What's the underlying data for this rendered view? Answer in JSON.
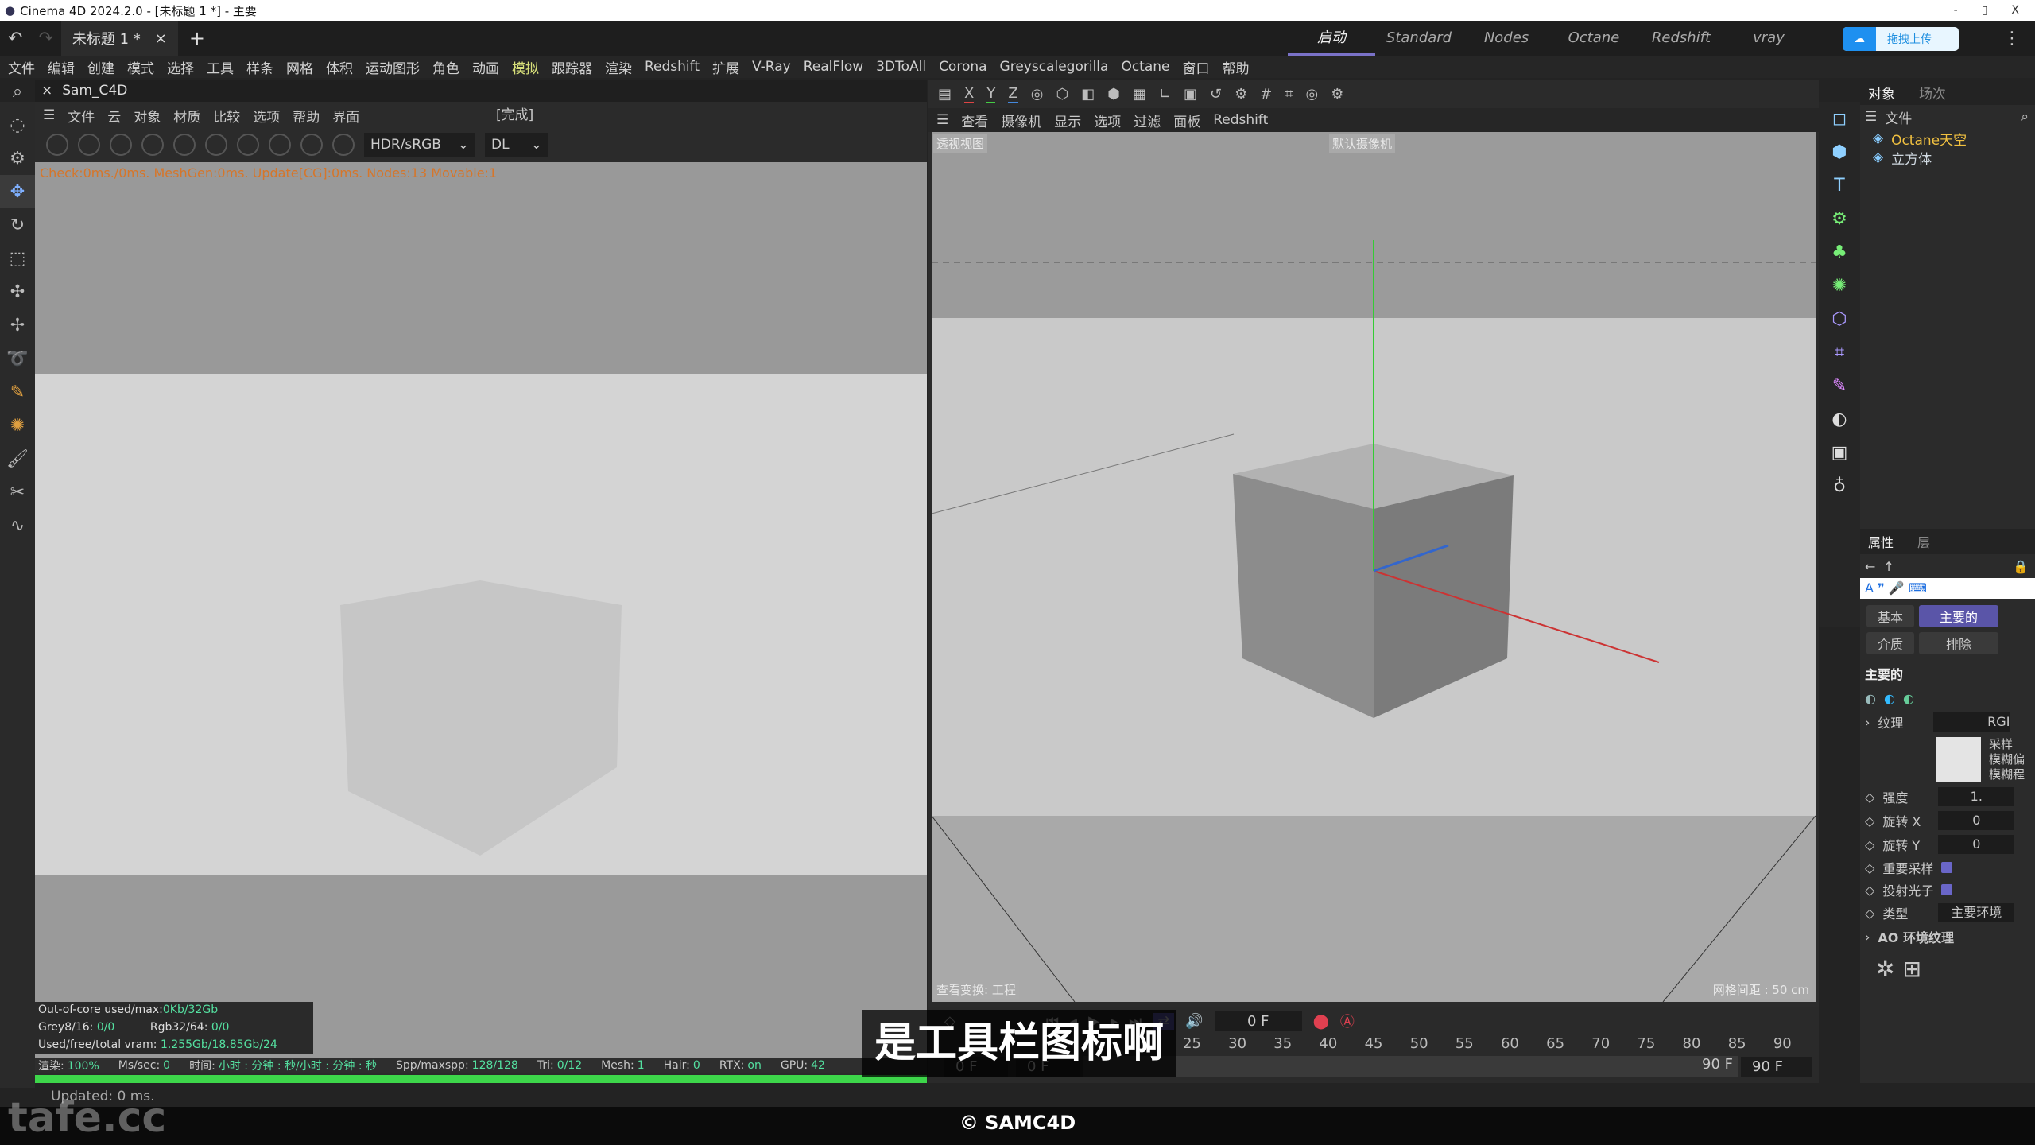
{
  "window": {
    "title": "Cinema 4D 2024.2.0 - [未标题 1 *] - 主要",
    "min": "-",
    "max": "▯",
    "close": "X"
  },
  "tabs": {
    "doc": "未标题 1 *",
    "close": "×",
    "add": "+",
    "layouts": [
      "启动",
      "Standard",
      "Nodes",
      "Octane",
      "Redshift",
      "vray"
    ],
    "active": "启动",
    "upload": "拖拽上传"
  },
  "menu": [
    "文件",
    "编辑",
    "创建",
    "模式",
    "选择",
    "工具",
    "样条",
    "网格",
    "体积",
    "运动图形",
    "角色",
    "动画",
    "模拟",
    "跟踪器",
    "渲染",
    "Redshift",
    "扩展",
    "V-Ray",
    "RealFlow",
    "3DToAll",
    "Corona",
    "Greyscalegorilla",
    "Octane",
    "窗口",
    "帮助"
  ],
  "octane": {
    "title": "Sam_C4D",
    "menu": [
      "文件",
      "云",
      "对象",
      "材质",
      "比较",
      "选项",
      "帮助",
      "界面"
    ],
    "state": "[完成]",
    "colorspace": "HDR/sRGB",
    "kernel": "DL",
    "status": "Check:0ms./0ms. MeshGen:0ms. Update[CG]:0ms. Nodes:13 Movable:1",
    "info": {
      "ooc_label": "Out-of-core used/max:",
      "ooc": "0Kb/32Gb",
      "grey_label": "Grey8/16:",
      "grey": "0/0",
      "rgb_label": "Rgb32/64:",
      "rgb": "0/0",
      "vram_label": "Used/free/total vram:",
      "vram": "1.255Gb/18.85Gb/24"
    },
    "bar": [
      {
        "l": "渲染:",
        "v": "100%"
      },
      {
        "l": "Ms/sec:",
        "v": "0"
      },
      {
        "l": "时间:",
        "v": "小时 : 分钟 : 秒/小时 : 分钟 : 秒"
      },
      {
        "l": "Spp/maxspp:",
        "v": "128/128"
      },
      {
        "l": "Tri:",
        "v": "0/12"
      },
      {
        "l": "Mesh:",
        "v": "1"
      },
      {
        "l": "Hair:",
        "v": "0"
      },
      {
        "l": "RTX:",
        "v": "on"
      },
      {
        "l": "GPU:",
        "v": "42"
      }
    ],
    "progress": 100
  },
  "status_bottom": "Updated: 0 ms.",
  "viewport": {
    "axes": [
      "X",
      "Y",
      "Z"
    ],
    "menu": [
      "查看",
      "摄像机",
      "显示",
      "选项",
      "过滤",
      "面板",
      "Redshift"
    ],
    "view_name": "透视视图",
    "camera": "默认摄像机",
    "transform": "查看变换: 工程",
    "grid": "网格间距 : 50 cm"
  },
  "timeline": {
    "current": "0 F",
    "ticks": [
      "25",
      "30",
      "35",
      "40",
      "45",
      "50",
      "55",
      "60",
      "65",
      "70",
      "75",
      "80",
      "85",
      "90"
    ],
    "start": "0 F",
    "start2": "0 F",
    "end": "90 F",
    "end2": "90 F"
  },
  "objects": {
    "tabs": [
      "对象",
      "场次"
    ],
    "menu": "文件",
    "items": [
      {
        "name": "Octane天空",
        "color": "#f0c040"
      },
      {
        "name": "立方体",
        "color": "#cfd8e0"
      }
    ]
  },
  "attributes": {
    "tabs": [
      "属性",
      "层"
    ],
    "buttons": [
      "基本",
      "主要的",
      "介质",
      "排除"
    ],
    "active": "主要的",
    "section": "主要的",
    "texture": "纹理",
    "texture_val": "RGI",
    "tex_side": [
      "采样",
      "模糊偏",
      "模糊程"
    ],
    "fields": [
      {
        "label": "强度",
        "value": "1."
      },
      {
        "label": "旋转 X",
        "value": "0"
      },
      {
        "label": "旋转 Y",
        "value": "0"
      }
    ],
    "checks": [
      {
        "label": "重要采样",
        "checked": true
      },
      {
        "label": "投射光子",
        "checked": true
      }
    ],
    "type_label": "类型",
    "type_value": "主要环境",
    "ao": "AO 环境纹理"
  },
  "subtitle": "是工具栏图标啊",
  "watermark": "tafe.cc",
  "copyright": "© SAMC4D"
}
